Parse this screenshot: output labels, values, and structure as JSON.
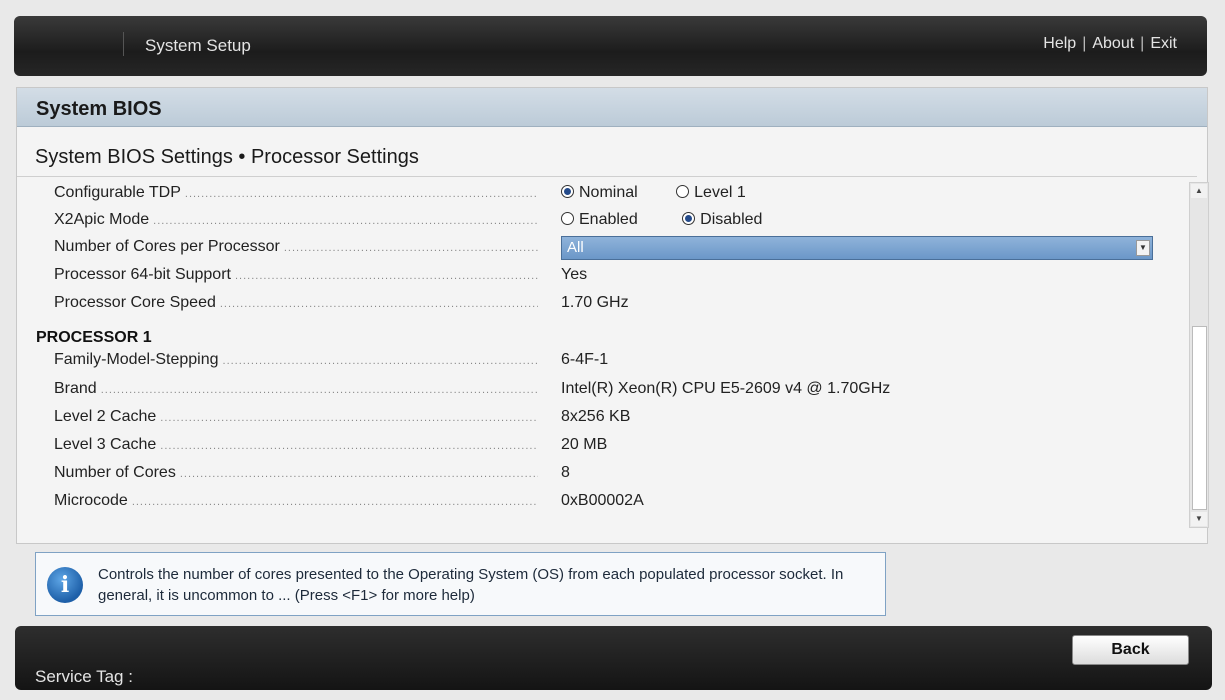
{
  "header": {
    "title": "System Setup",
    "links": {
      "help": "Help",
      "about": "About",
      "exit": "Exit"
    },
    "separator": "|"
  },
  "panel": {
    "title": "System BIOS",
    "breadcrumb": "System BIOS Settings • Processor Settings"
  },
  "settings": {
    "configurable_tdp": {
      "label": "Configurable TDP",
      "options": [
        "Nominal",
        "Level 1"
      ],
      "selected": "Nominal"
    },
    "x2apic_mode": {
      "label": "X2Apic Mode",
      "options": [
        "Enabled",
        "Disabled"
      ],
      "selected": "Disabled"
    },
    "cores_per_processor": {
      "label": "Number of Cores per Processor",
      "value": "All"
    },
    "processor_64bit": {
      "label": "Processor 64-bit Support",
      "value": "Yes"
    },
    "core_speed": {
      "label": "Processor Core Speed",
      "value": "1.70 GHz"
    }
  },
  "processor1": {
    "heading": "PROCESSOR 1",
    "rows": [
      {
        "label": "Family-Model-Stepping",
        "value": "6-4F-1"
      },
      {
        "label": "Brand",
        "value": "Intel(R) Xeon(R) CPU E5-2609 v4 @ 1.70GHz"
      },
      {
        "label": "Level 2 Cache",
        "value": "8x256 KB"
      },
      {
        "label": "Level 3 Cache",
        "value": "20 MB"
      },
      {
        "label": "Number of Cores",
        "value": "8"
      },
      {
        "label": "Microcode",
        "value": "0xB00002A"
      }
    ]
  },
  "help": {
    "icon": "info-icon",
    "text": "Controls the number of cores presented to the Operating System (OS) from each populated processor socket. In general, it is uncommon to ... (Press <F1> for more help)"
  },
  "footer": {
    "service_tag_label": "Service Tag :",
    "back_label": "Back"
  },
  "colors": {
    "accent": "#6b97c8",
    "header_bg": "#1c1c1c",
    "panel_head": "#bccbd8"
  }
}
